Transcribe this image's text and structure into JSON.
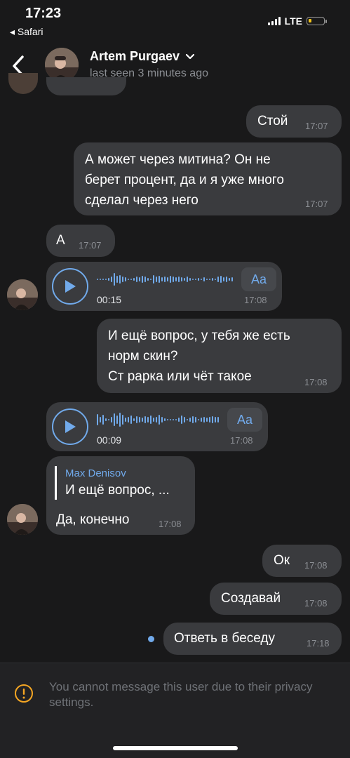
{
  "status_bar": {
    "time": "17:23",
    "back_app": "◂ Safari",
    "network": "LTE"
  },
  "header": {
    "name": "Artem Purgaev",
    "last_seen": "last seen 3 minutes ago"
  },
  "messages": [
    {
      "text": "Стой",
      "time": "17:07"
    },
    {
      "lines": [
        "А может через митина? Он не",
        "берет процент, да и я уже много",
        "сделал через него"
      ],
      "time": "17:07"
    },
    {
      "text": "А",
      "time": "17:07"
    },
    {
      "duration": "00:15",
      "time": "17:08",
      "transcribe": "Aa"
    },
    {
      "lines": [
        "И ещё вопрос, у тебя же есть",
        "норм скин?",
        "Ст рарка или чёт такое"
      ],
      "time": "17:08"
    },
    {
      "duration": "00:09",
      "time": "17:08",
      "transcribe": "Aa"
    },
    {
      "reply_author": "Max Denisov",
      "reply_text": "И ещё вопрос, ...",
      "text": "Да, конечно",
      "time": "17:08"
    },
    {
      "text": "Ок",
      "time": "17:08"
    },
    {
      "text": "Создавай",
      "time": "17:08"
    },
    {
      "text": "Ответь в беседу",
      "time": "17:18"
    }
  ],
  "footer": {
    "notice": "You cannot message this user due to their privacy settings."
  },
  "colors": {
    "background": "#19191a",
    "bubble": "#3a3b3e",
    "accent": "#71aaeb",
    "footer": "#222224"
  }
}
